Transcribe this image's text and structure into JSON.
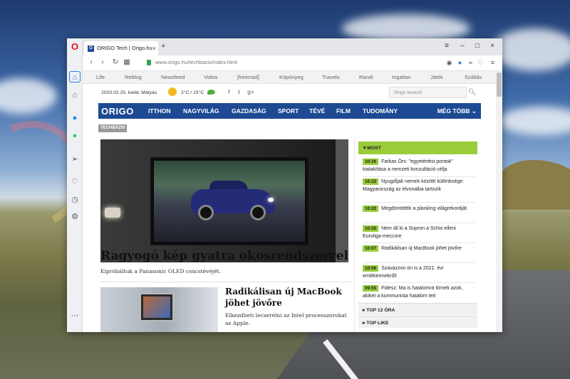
{
  "browser": {
    "tab_title": "ORIGO Tech | Origo.hu",
    "tab_favicon": "O",
    "tab_close": "×",
    "new_tab": "+",
    "url_domain": "www.origo.hu",
    "url_path": "/techbazis/index.html",
    "window_controls": [
      "≡",
      "–",
      "□",
      "×"
    ]
  },
  "site": {
    "top_links": [
      "Life",
      "Reblog",
      "Newsfeed",
      "Videa",
      "[freemail]",
      "Köpönyeg",
      "Travelo",
      "Randi",
      "Ingatlan",
      "Játék",
      "Szállás"
    ],
    "date": "2020.02.25. kedd, Mátyás",
    "weather": "2°C / 15°C",
    "social": [
      "f",
      "t",
      "g+"
    ],
    "search_placeholder": "Origo kereső",
    "logo": "ORIGO",
    "nav_items": [
      "ITTHON",
      "NAGYVILÁG",
      "GAZDASÁG",
      "SPORT",
      "TÉVÉ",
      "FILM",
      "TUDOMÁNY"
    ],
    "nav_more": "MÉG TÖBB ⌄",
    "section_tag": "TECHBÁZIS"
  },
  "lead": {
    "headline": "Ragyogó kép gyatra okosrendszerrel",
    "subline": "Kipróbáltuk a Panasonic OLED csúcstévéjét."
  },
  "article2": {
    "title": "Radikálisan új MacBook jöhet jövőre",
    "sub": "Elkezdheti lecserélni az Intel processzorokat az Apple."
  },
  "news": {
    "header": "▾ MOST",
    "items": [
      {
        "time": "10:26",
        "text": "Farkas Örs: \"egyetértési pontok\" kialakítása a nemzeti konzultáció célja"
      },
      {
        "time": "10:22",
        "text": "Nyugdíjak nemek közötti különbsége: Magyarország az élvonalba tartozik"
      },
      {
        "time": "10:22",
        "text": "Megdöntötték a planking világrekordját"
      },
      {
        "time": "10:20",
        "text": "Nem áll ki a Sopron a Schio elleni Euroliga-meccsre"
      },
      {
        "time": "10:07",
        "text": "Radikálisan új MacBook jöhet jövőre"
      },
      {
        "time": "10:06",
        "text": "Szavazzon ön is a 2021. évi emlékérmekről!"
      },
      {
        "time": "09:55",
        "text": "Fidesz: Ma is hatalomra törnek azok, akiket a kommunista hatalom tett"
      }
    ],
    "accordion": [
      "▸ TOP 12 ÓRA",
      "▸ TOP LIKE"
    ]
  }
}
